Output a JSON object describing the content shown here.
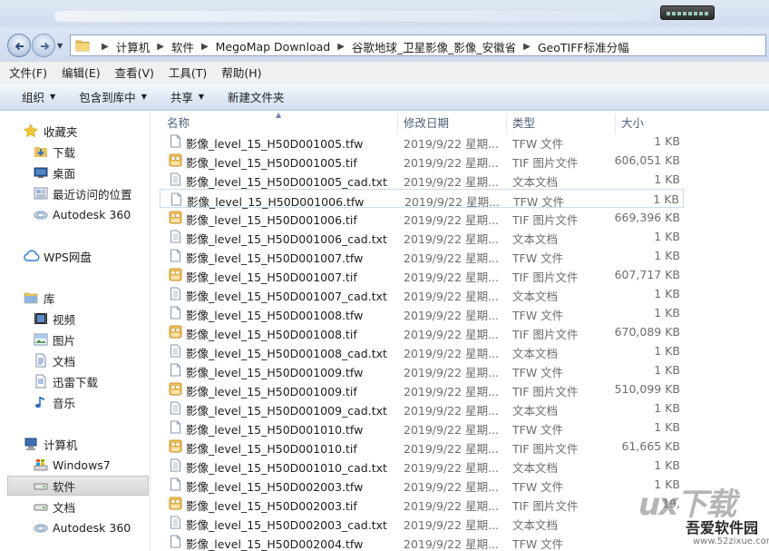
{
  "address": {
    "crumbs": [
      "计算机",
      "软件",
      "MegoMap Download",
      "谷歌地球_卫星影像_影像_安徽省",
      "GeoTIFF标准分幅"
    ]
  },
  "menu": [
    "文件(F)",
    "编辑(E)",
    "查看(V)",
    "工具(T)",
    "帮助(H)"
  ],
  "commands": {
    "organize": "组织",
    "include_in_library": "包含到库中",
    "share": "共享",
    "new_folder": "新建文件夹"
  },
  "sidebar": {
    "favorites": {
      "label": "收藏夹",
      "items": [
        "下载",
        "桌面",
        "最近访问的位置",
        "Autodesk 360"
      ]
    },
    "wps": "WPS网盘",
    "libraries": {
      "label": "库",
      "items": [
        "视频",
        "图片",
        "文档",
        "迅雷下载",
        "音乐"
      ]
    },
    "computer": {
      "label": "计算机",
      "items": [
        "Windows7",
        "软件",
        "文档",
        "Autodesk 360"
      ]
    }
  },
  "columns": {
    "name": "名称",
    "date": "修改日期",
    "type": "类型",
    "size": "大小"
  },
  "files": [
    {
      "name": "影像_level_15_H50D001005.tfw",
      "date": "2019/9/22 星期...",
      "type": "TFW 文件",
      "size": "1 KB",
      "kind": "doc"
    },
    {
      "name": "影像_level_15_H50D001005.tif",
      "date": "2019/9/22 星期...",
      "type": "TIF 图片文件",
      "size": "606,051 KB",
      "kind": "img"
    },
    {
      "name": "影像_level_15_H50D001005_cad.txt",
      "date": "2019/9/22 星期...",
      "type": "文本文档",
      "size": "1 KB",
      "kind": "txt"
    },
    {
      "name": "影像_level_15_H50D001006.tfw",
      "date": "2019/9/22 星期...",
      "type": "TFW 文件",
      "size": "1 KB",
      "kind": "doc"
    },
    {
      "name": "影像_level_15_H50D001006.tif",
      "date": "2019/9/22 星期...",
      "type": "TIF 图片文件",
      "size": "669,396 KB",
      "kind": "img"
    },
    {
      "name": "影像_level_15_H50D001006_cad.txt",
      "date": "2019/9/22 星期...",
      "type": "文本文档",
      "size": "1 KB",
      "kind": "txt"
    },
    {
      "name": "影像_level_15_H50D001007.tfw",
      "date": "2019/9/22 星期...",
      "type": "TFW 文件",
      "size": "1 KB",
      "kind": "doc"
    },
    {
      "name": "影像_level_15_H50D001007.tif",
      "date": "2019/9/22 星期...",
      "type": "TIF 图片文件",
      "size": "607,717 KB",
      "kind": "img"
    },
    {
      "name": "影像_level_15_H50D001007_cad.txt",
      "date": "2019/9/22 星期...",
      "type": "文本文档",
      "size": "1 KB",
      "kind": "txt"
    },
    {
      "name": "影像_level_15_H50D001008.tfw",
      "date": "2019/9/22 星期...",
      "type": "TFW 文件",
      "size": "1 KB",
      "kind": "doc"
    },
    {
      "name": "影像_level_15_H50D001008.tif",
      "date": "2019/9/22 星期...",
      "type": "TIF 图片文件",
      "size": "670,089 KB",
      "kind": "img"
    },
    {
      "name": "影像_level_15_H50D001008_cad.txt",
      "date": "2019/9/22 星期...",
      "type": "文本文档",
      "size": "1 KB",
      "kind": "txt"
    },
    {
      "name": "影像_level_15_H50D001009.tfw",
      "date": "2019/9/22 星期...",
      "type": "TFW 文件",
      "size": "1 KB",
      "kind": "doc"
    },
    {
      "name": "影像_level_15_H50D001009.tif",
      "date": "2019/9/22 星期...",
      "type": "TIF 图片文件",
      "size": "510,099 KB",
      "kind": "img"
    },
    {
      "name": "影像_level_15_H50D001009_cad.txt",
      "date": "2019/9/22 星期...",
      "type": "文本文档",
      "size": "1 KB",
      "kind": "txt"
    },
    {
      "name": "影像_level_15_H50D001010.tfw",
      "date": "2019/9/22 星期...",
      "type": "TFW 文件",
      "size": "1 KB",
      "kind": "doc"
    },
    {
      "name": "影像_level_15_H50D001010.tif",
      "date": "2019/9/22 星期...",
      "type": "TIF 图片文件",
      "size": "61,665 KB",
      "kind": "img"
    },
    {
      "name": "影像_level_15_H50D001010_cad.txt",
      "date": "2019/9/22 星期...",
      "type": "文本文档",
      "size": "1 KB",
      "kind": "txt"
    },
    {
      "name": "影像_level_15_H50D002003.tfw",
      "date": "2019/9/22 星期...",
      "type": "TFW 文件",
      "size": "1 KB",
      "kind": "doc"
    },
    {
      "name": "影像_level_15_H50D002003.tif",
      "date": "2019/9/22 星期...",
      "type": "TIF 图片文件",
      "size": "19,",
      "kind": "img"
    },
    {
      "name": "影像_level_15_H50D002003_cad.txt",
      "date": "2019/9/22 星期...",
      "type": "文本文档",
      "size": "",
      "kind": "txt"
    },
    {
      "name": "影像_level_15_H50D002004.tfw",
      "date": "2019/9/22 星期...",
      "type": "TFW 文件",
      "size": "",
      "kind": "doc"
    }
  ],
  "watermark": {
    "logo": "ux下载",
    "site": "吾爱软件园",
    "url": "www.52zixue.com"
  }
}
